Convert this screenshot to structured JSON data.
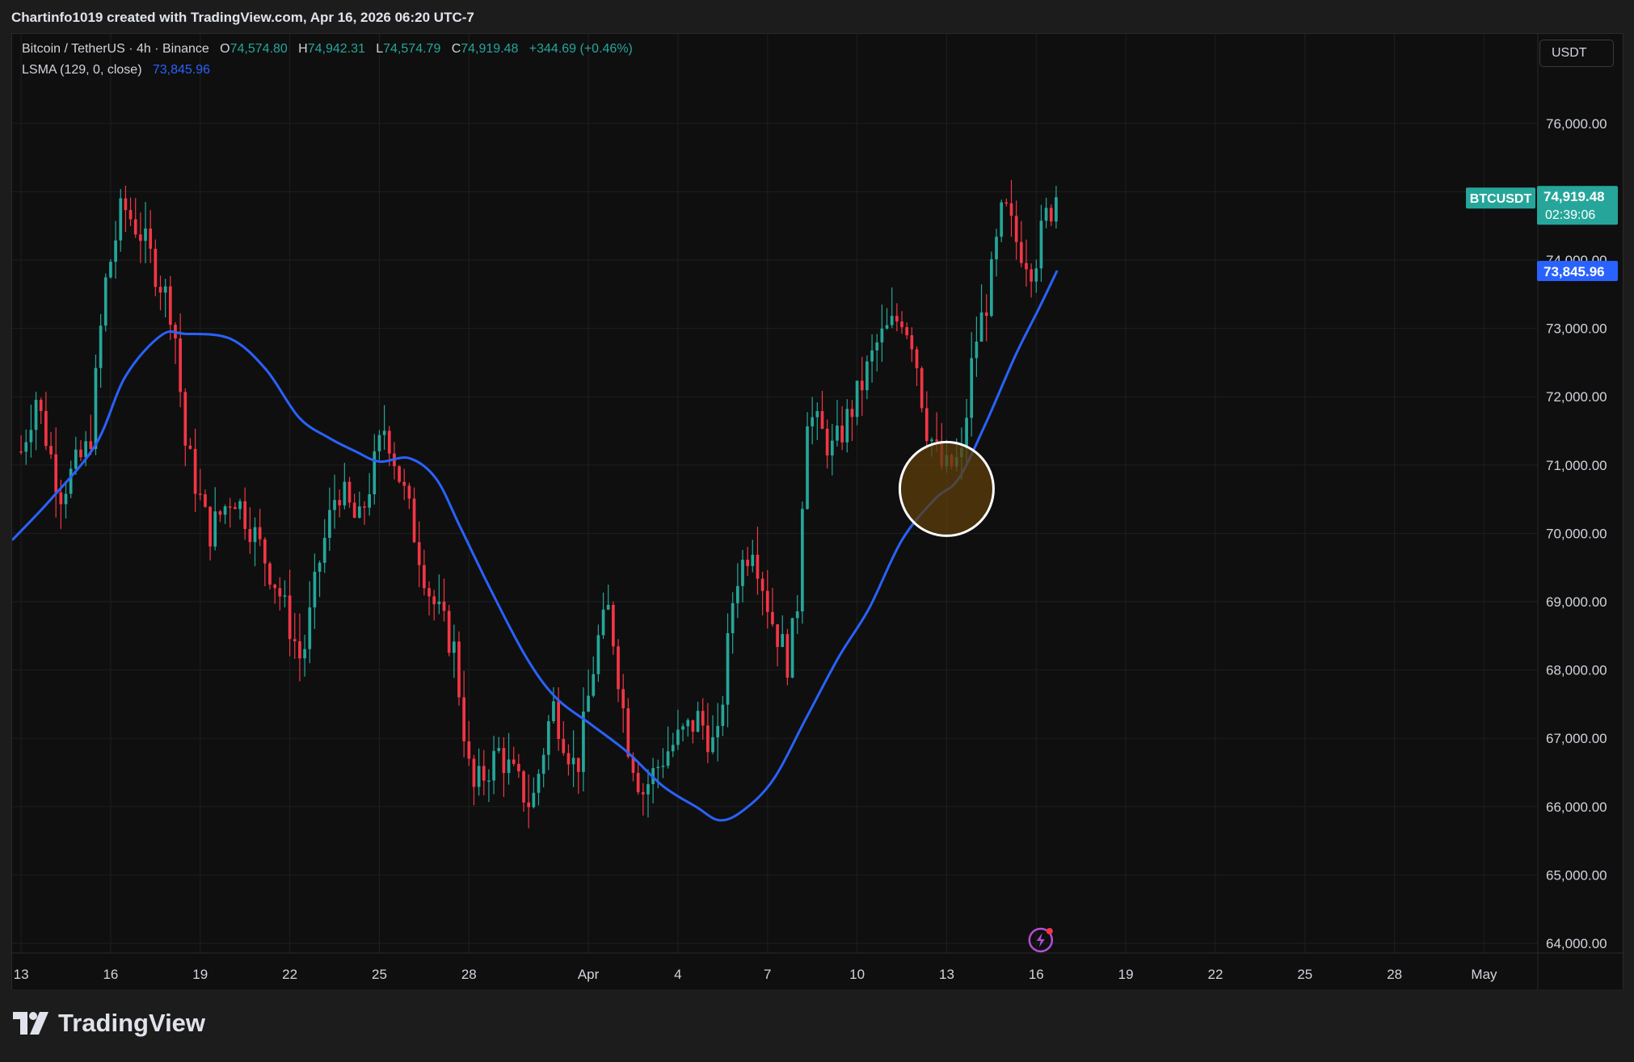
{
  "header": {
    "credit": "Chartinfo1019 created with TradingView.com, Apr 16, 2026 06:20 UTC-7"
  },
  "legend": {
    "symbol": "Bitcoin / TetherUS · 4h · Binance",
    "o_key": "O",
    "o_val": "74,574.80",
    "h_key": "H",
    "h_val": "74,942.31",
    "l_key": "L",
    "l_val": "74,574.79",
    "c_key": "C",
    "c_val": "74,919.48",
    "change": "+344.69 (+0.46%)",
    "indicator": "LSMA (129, 0, close)",
    "indicator_val": "73,845.96"
  },
  "currency_button": "USDT",
  "price_tags": {
    "symbol_label": "BTCUSDT",
    "last_price": "74,919.48",
    "countdown": "02:39:06",
    "lsma_price": "73,845.96"
  },
  "brand": {
    "name": "TradingView"
  },
  "colors": {
    "up": "#26a69a",
    "down": "#f23645",
    "lsma": "#2962ff",
    "background": "#0f0f0f",
    "highlight_circle_fill": "#5c3d0b",
    "highlight_circle_stroke": "#ffffff"
  },
  "icons": {
    "alert": "lightning-alert-icon",
    "logo": "tradingview-logo-icon"
  },
  "chart_data": {
    "type": "candlestick",
    "title": "Bitcoin / TetherUS · 4h · Binance",
    "timeframe": "4h",
    "ylim": [
      63800,
      77000
    ],
    "y_ticks": [
      64000,
      65000,
      66000,
      67000,
      68000,
      69000,
      70000,
      71000,
      72000,
      73000,
      74000,
      75000,
      76000
    ],
    "y_tick_labels": [
      "64,000.00",
      "65,000.00",
      "66,000.00",
      "67,000.00",
      "68,000.00",
      "69,000.00",
      "70,000.00",
      "71,000.00",
      "72,000.00",
      "73,000.00",
      "74,000.00",
      "75,000.00",
      "76,000.00"
    ],
    "x_tick_labels": [
      {
        "label": "13",
        "day": 0
      },
      {
        "label": "16",
        "day": 3
      },
      {
        "label": "19",
        "day": 6
      },
      {
        "label": "22",
        "day": 9
      },
      {
        "label": "25",
        "day": 12
      },
      {
        "label": "28",
        "day": 15
      },
      {
        "label": "Apr",
        "day": 19
      },
      {
        "label": "4",
        "day": 22
      },
      {
        "label": "7",
        "day": 25
      },
      {
        "label": "10",
        "day": 28
      },
      {
        "label": "13",
        "day": 31
      },
      {
        "label": "16",
        "day": 34
      },
      {
        "label": "19",
        "day": 37
      },
      {
        "label": "22",
        "day": 40
      },
      {
        "label": "25",
        "day": 43
      },
      {
        "label": "28",
        "day": 46
      },
      {
        "label": "May",
        "day": 49
      }
    ],
    "x_range_days": [
      -0.3,
      50.8
    ],
    "price_keypoints": [
      {
        "day": 0.0,
        "close": 71200
      },
      {
        "day": 0.5,
        "close": 72000
      },
      {
        "day": 1.3,
        "close": 70600
      },
      {
        "day": 2.3,
        "close": 71300
      },
      {
        "day": 2.8,
        "close": 73600
      },
      {
        "day": 3.4,
        "close": 74800
      },
      {
        "day": 4.0,
        "close": 74400
      },
      {
        "day": 5.1,
        "close": 73200
      },
      {
        "day": 5.5,
        "close": 71300
      },
      {
        "day": 6.3,
        "close": 70000
      },
      {
        "day": 7.1,
        "close": 70600
      },
      {
        "day": 7.7,
        "close": 70100
      },
      {
        "day": 8.6,
        "close": 69200
      },
      {
        "day": 9.4,
        "close": 68100
      },
      {
        "day": 10.0,
        "close": 69600
      },
      {
        "day": 10.6,
        "close": 70700
      },
      {
        "day": 11.3,
        "close": 70100
      },
      {
        "day": 12.2,
        "close": 71600
      },
      {
        "day": 13.0,
        "close": 70300
      },
      {
        "day": 13.7,
        "close": 69100
      },
      {
        "day": 14.5,
        "close": 68300
      },
      {
        "day": 15.1,
        "close": 66200
      },
      {
        "day": 16.0,
        "close": 66800
      },
      {
        "day": 17.1,
        "close": 66000
      },
      {
        "day": 17.8,
        "close": 67500
      },
      {
        "day": 18.6,
        "close": 66500
      },
      {
        "day": 19.3,
        "close": 68400
      },
      {
        "day": 19.7,
        "close": 68900
      },
      {
        "day": 20.3,
        "close": 67000
      },
      {
        "day": 20.8,
        "close": 66200
      },
      {
        "day": 21.6,
        "close": 66800
      },
      {
        "day": 22.7,
        "close": 67300
      },
      {
        "day": 23.3,
        "close": 66800
      },
      {
        "day": 23.9,
        "close": 69300
      },
      {
        "day": 24.5,
        "close": 69900
      },
      {
        "day": 25.1,
        "close": 68800
      },
      {
        "day": 25.7,
        "close": 68100
      },
      {
        "day": 26.0,
        "close": 69000
      },
      {
        "day": 26.3,
        "close": 71800
      },
      {
        "day": 27.2,
        "close": 71200
      },
      {
        "day": 28.0,
        "close": 72000
      },
      {
        "day": 28.7,
        "close": 72800
      },
      {
        "day": 29.5,
        "close": 73200
      },
      {
        "day": 29.9,
        "close": 72800
      },
      {
        "day": 30.3,
        "close": 71600
      },
      {
        "day": 30.9,
        "close": 70900
      },
      {
        "day": 31.5,
        "close": 71100
      },
      {
        "day": 31.9,
        "close": 72700
      },
      {
        "day": 32.4,
        "close": 73500
      },
      {
        "day": 32.9,
        "close": 74800
      },
      {
        "day": 33.3,
        "close": 74300
      },
      {
        "day": 33.9,
        "close": 73900
      },
      {
        "day": 34.3,
        "close": 74600
      },
      {
        "day": 34.7,
        "close": 74919.48
      }
    ],
    "series": [
      {
        "name": "LSMA (129, 0, close)",
        "last_value": 73845.96,
        "points": [
          {
            "day": -0.3,
            "value": 69900
          },
          {
            "day": 1.0,
            "value": 70500
          },
          {
            "day": 2.5,
            "value": 71300
          },
          {
            "day": 3.5,
            "value": 72300
          },
          {
            "day": 4.7,
            "value": 72900
          },
          {
            "day": 5.5,
            "value": 72920
          },
          {
            "day": 7.0,
            "value": 72850
          },
          {
            "day": 8.2,
            "value": 72400
          },
          {
            "day": 9.3,
            "value": 71700
          },
          {
            "day": 10.3,
            "value": 71400
          },
          {
            "day": 11.2,
            "value": 71200
          },
          {
            "day": 12.0,
            "value": 71050
          },
          {
            "day": 13.0,
            "value": 71100
          },
          {
            "day": 13.9,
            "value": 70800
          },
          {
            "day": 14.7,
            "value": 70100
          },
          {
            "day": 15.7,
            "value": 69200
          },
          {
            "day": 16.9,
            "value": 68200
          },
          {
            "day": 17.9,
            "value": 67600
          },
          {
            "day": 19.1,
            "value": 67200
          },
          {
            "day": 20.3,
            "value": 66800
          },
          {
            "day": 21.5,
            "value": 66300
          },
          {
            "day": 22.6,
            "value": 66000
          },
          {
            "day": 23.4,
            "value": 65800
          },
          {
            "day": 24.2,
            "value": 65950
          },
          {
            "day": 25.2,
            "value": 66400
          },
          {
            "day": 26.3,
            "value": 67300
          },
          {
            "day": 27.4,
            "value": 68200
          },
          {
            "day": 28.4,
            "value": 68900
          },
          {
            "day": 29.5,
            "value": 69900
          },
          {
            "day": 30.6,
            "value": 70500
          },
          {
            "day": 31.4,
            "value": 70800
          },
          {
            "day": 32.3,
            "value": 71600
          },
          {
            "day": 33.3,
            "value": 72600
          },
          {
            "day": 34.1,
            "value": 73300
          },
          {
            "day": 34.7,
            "value": 73845.96
          }
        ]
      }
    ],
    "annotations": [
      {
        "type": "circle",
        "day": 31.0,
        "price": 70650,
        "label": ""
      }
    ],
    "grid": true,
    "legend_position": "top-left"
  }
}
